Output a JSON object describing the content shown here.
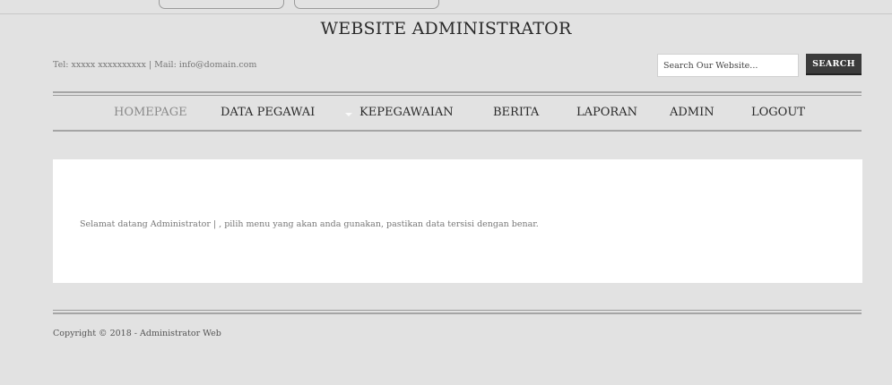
{
  "header": {
    "title": "WEBSITE ADMINISTRATOR",
    "contact": "Tel: xxxxx xxxxxxxxxx | Mail: info@domain.com"
  },
  "search": {
    "value": "Search Our Website...",
    "button_label": "SEARCH"
  },
  "nav": {
    "items": [
      {
        "label": "HOMEPAGE"
      },
      {
        "label": "DATA PEGAWAI"
      },
      {
        "label": "KEPEGAWAIAN"
      },
      {
        "label": "BERITA"
      },
      {
        "label": "LAPORAN"
      },
      {
        "label": "ADMIN"
      },
      {
        "label": "LOGOUT"
      }
    ]
  },
  "content": {
    "welcome": "Selamat datang Administrator | , pilih menu yang akan anda gunakan, pastikan data tersisi dengan benar."
  },
  "footer": {
    "copyright": "Copyright © 2018 - Administrator Web"
  }
}
